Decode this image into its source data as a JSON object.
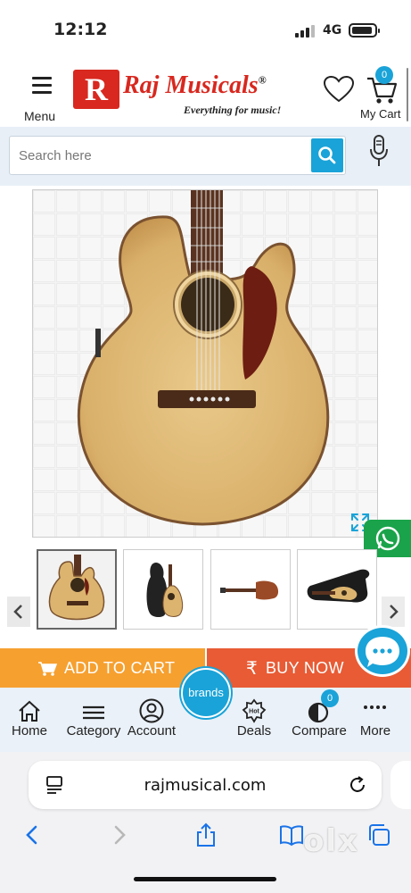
{
  "status_bar": {
    "time": "12:12",
    "network": "4G"
  },
  "header": {
    "menu_label": "Menu",
    "logo_letter": "R",
    "brand_name": "Raj Musicals",
    "registered": "®",
    "tagline": "Everything for music!",
    "cart_label": "My Cart",
    "cart_count": "0"
  },
  "search": {
    "placeholder": "Search here"
  },
  "actions": {
    "add_to_cart": "ADD TO CART",
    "buy_now": "BUY NOW"
  },
  "brands_label": "brands",
  "bottom_nav": {
    "home": "Home",
    "category": "Category",
    "account": "Account",
    "deals": "Deals",
    "deals_badge": "Hot",
    "compare": "Compare",
    "compare_count": "0",
    "more": "More"
  },
  "browser": {
    "url": "rajmusical.com"
  },
  "watermark": "olx",
  "colors": {
    "brand_red": "#d8281f",
    "accent_blue": "#1aa3d8",
    "add_to_cart": "#f6a030",
    "buy_now": "#e85b35",
    "whatsapp": "#1aa34a"
  }
}
